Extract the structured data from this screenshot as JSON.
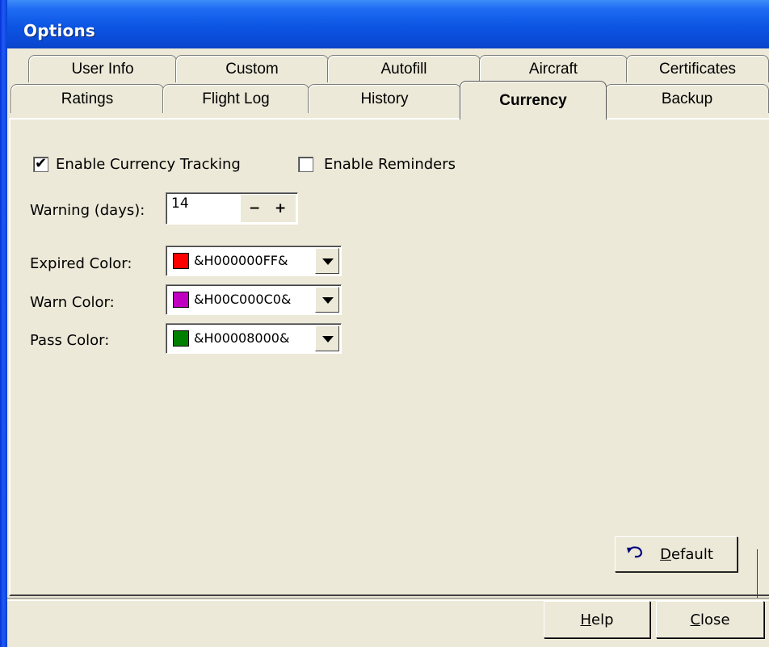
{
  "window": {
    "title": "Options"
  },
  "tabs_row1": [
    "User Info",
    "Custom",
    "Autofill",
    "Aircraft",
    "Certificates"
  ],
  "tabs_row2": [
    "Ratings",
    "Flight Log",
    "History",
    "Currency",
    "Backup"
  ],
  "active_tab": "Currency",
  "currency": {
    "enable_tracking_label": "Enable Currency Tracking",
    "enable_tracking_checked": true,
    "enable_reminders_label": "Enable Reminders",
    "enable_reminders_checked": false,
    "warning_label": "Warning (days):",
    "warning_value": "14",
    "minus": "−",
    "plus": "+",
    "expired_label": "Expired Color:",
    "expired_value": "&H000000FF&",
    "expired_color": "#ff0000",
    "warn_label": "Warn Color:",
    "warn_value": "&H00C000C0&",
    "warn_color": "#c000c0",
    "pass_label": "Pass Color:",
    "pass_value": "&H00008000&",
    "pass_color": "#008000"
  },
  "buttons": {
    "default_label": "Default",
    "default_icon": "undo-icon",
    "help_label": "Help",
    "close_label": "Close"
  }
}
